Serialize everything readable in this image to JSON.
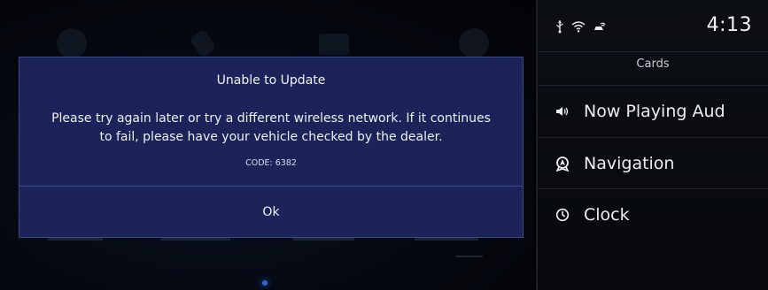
{
  "dialog": {
    "title": "Unable to Update",
    "message": "Please try again later or try a different wireless network. If it continues\nto fail, please have your vehicle checked by the dealer.",
    "code": "CODE: 6382",
    "ok_label": "Ok"
  },
  "status": {
    "time": "4:13",
    "icons": [
      "usb-icon",
      "wifi-icon",
      "connected-car-icon"
    ]
  },
  "panel": {
    "title": "Cards",
    "items": [
      {
        "label": "Now Playing Aud",
        "icon": "speaker-icon"
      },
      {
        "label": "Navigation",
        "icon": "navigation-icon"
      },
      {
        "label": "Clock",
        "icon": "clock-icon"
      }
    ]
  },
  "colors": {
    "dialog_bg": "#1b2358",
    "dialog_border": "#3a4a86",
    "panel_bg": "#0c0f14",
    "text": "#eceef3"
  }
}
